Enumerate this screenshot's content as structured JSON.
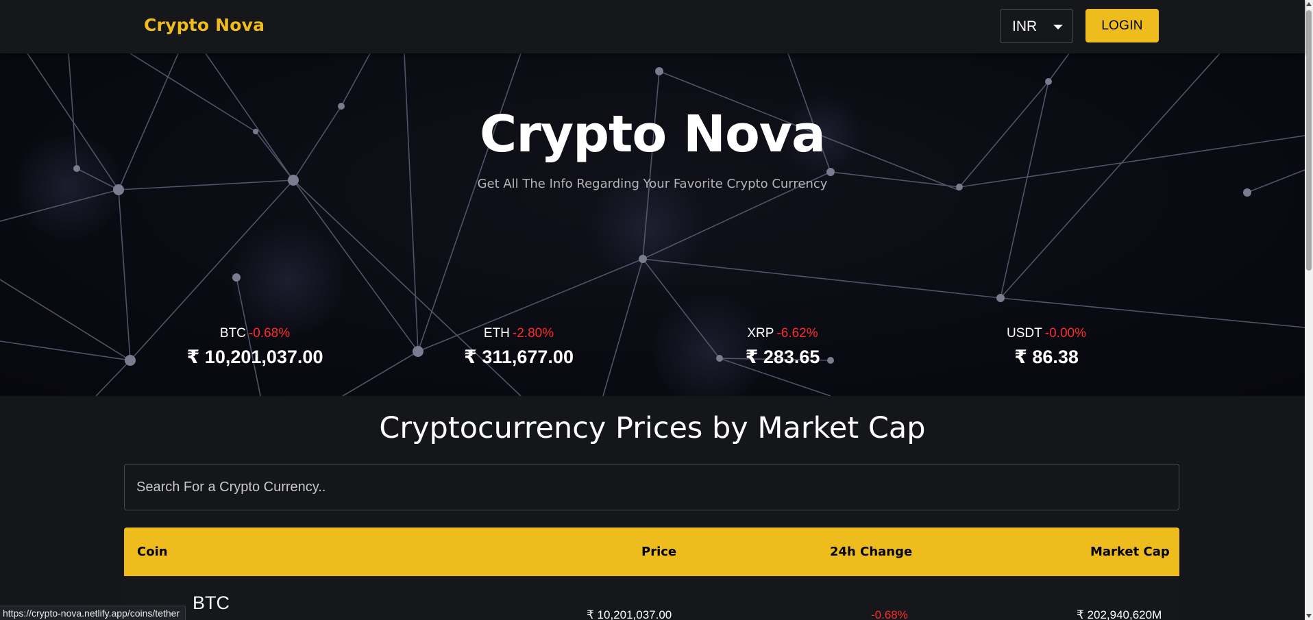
{
  "header": {
    "brand": "Crypto Nova",
    "currency": "INR",
    "login_label": "LOGIN"
  },
  "hero": {
    "title": "Crypto Nova",
    "subtitle": "Get All The Info Regarding Your Favorite Crypto Currency",
    "tickers": [
      {
        "symbol": "BTC",
        "change": "-0.68%",
        "price": "₹ 10,201,037.00"
      },
      {
        "symbol": "ETH",
        "change": "-2.80%",
        "price": "₹ 311,677.00"
      },
      {
        "symbol": "XRP",
        "change": "-6.62%",
        "price": "₹ 283.65"
      },
      {
        "symbol": "USDT",
        "change": "-0.00%",
        "price": "₹ 86.38"
      }
    ]
  },
  "market": {
    "title": "Cryptocurrency Prices by Market Cap",
    "search_placeholder": "Search For a Crypto Currency..",
    "columns": [
      "Coin",
      "Price",
      "24h Change",
      "Market Cap"
    ],
    "rows": [
      {
        "symbol": "BTC",
        "price": "₹ 10,201,037.00",
        "change": "-0.68%",
        "market_cap": "₹ 202,940,620M"
      }
    ]
  },
  "status_bar": {
    "url": "https://crypto-nova.netlify.app/coins/tether"
  },
  "colors": {
    "accent": "#eebc1d",
    "negative": "#ff2b2b",
    "background": "#14161a"
  }
}
